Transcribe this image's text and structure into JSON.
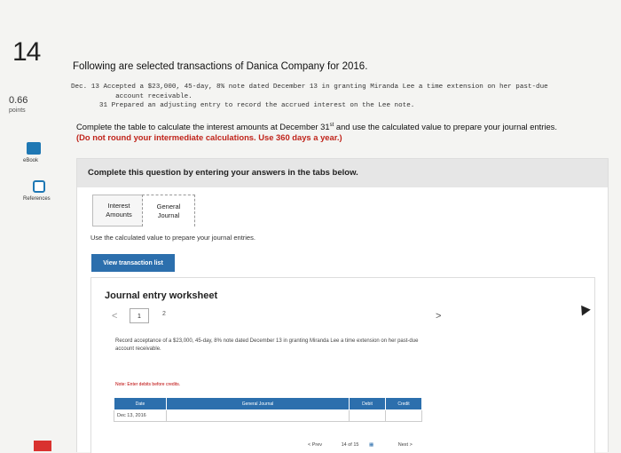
{
  "question": {
    "number": "14",
    "points_value": "0.66",
    "points_label": "points"
  },
  "sidebar": {
    "ebook_label": "eBook",
    "references_label": "References"
  },
  "intro": "Following are selected transactions of Danica Company for 2016.",
  "transactions": [
    "Dec. 13 Accepted a $23,000, 45-day, 8% note dated December 13 in granting Miranda Lee a time extension on her past-due",
    "           account receivable.",
    "       31 Prepared an adjusting entry to record the accrued interest on the Lee note."
  ],
  "instructions": {
    "text_before_sup": "Complete the table to calculate the interest amounts at December 31",
    "sup": "st",
    "text_after_sup": " and use the calculated value to prepare your journal entries.",
    "red_text": "(Do not round your intermediate calculations. Use 360 days a year.)"
  },
  "panel": {
    "heading": "Complete this question by entering your answers in the tabs below.",
    "tabs": [
      {
        "line1": "Interest",
        "line2": "Amounts"
      },
      {
        "line1": "General",
        "line2": "Journal"
      }
    ],
    "use_text": "Use the calculated value to prepare your journal entries.",
    "view_button": "View transaction list"
  },
  "worksheet": {
    "title": "Journal entry worksheet",
    "nav_prev": "<",
    "nav_next": ">",
    "page1": "1",
    "page2": "2",
    "description": "Record acceptance of a $23,000, 45-day, 8% note dated December 13 in granting Miranda Lee a time extension on her past-due account receivable.",
    "note": "Note: Enter debits before credits.",
    "table": {
      "headers": [
        "Date",
        "General Journal",
        "Debit",
        "Credit"
      ],
      "rows": [
        [
          "Dec 13, 2016",
          "",
          "",
          ""
        ]
      ]
    }
  },
  "bottom_nav": {
    "prev": "< Prev",
    "page_info": "14 of 15",
    "next": "Next >"
  }
}
